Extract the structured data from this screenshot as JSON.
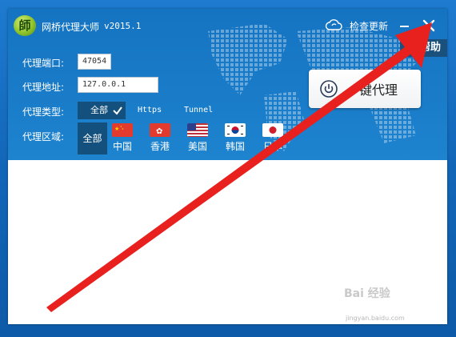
{
  "app": {
    "logo_text": "師",
    "title": "网桥代理大师",
    "version": "v2015.1",
    "update_label": "检查更新",
    "help_label": "帮助"
  },
  "form": {
    "port_label": "代理端口:",
    "port_value": "47054",
    "address_label": "代理地址:",
    "address_value": "127.0.0.1",
    "type_label": "代理类型:",
    "types": [
      "全部",
      "Https",
      "Tunnel"
    ],
    "region_label": "代理区域:",
    "region_all": "全部",
    "regions": [
      "中国",
      "香港",
      "美国",
      "韩国",
      "日本"
    ]
  },
  "action": {
    "one_key_label": "一键代理"
  },
  "watermark": {
    "text": "Bai 经验",
    "url": "jingyan.baidu.com"
  },
  "colors": {
    "header_blue": "#1a7cc9",
    "selected_dark": "#14507d",
    "arrow_red": "#e8201e"
  }
}
